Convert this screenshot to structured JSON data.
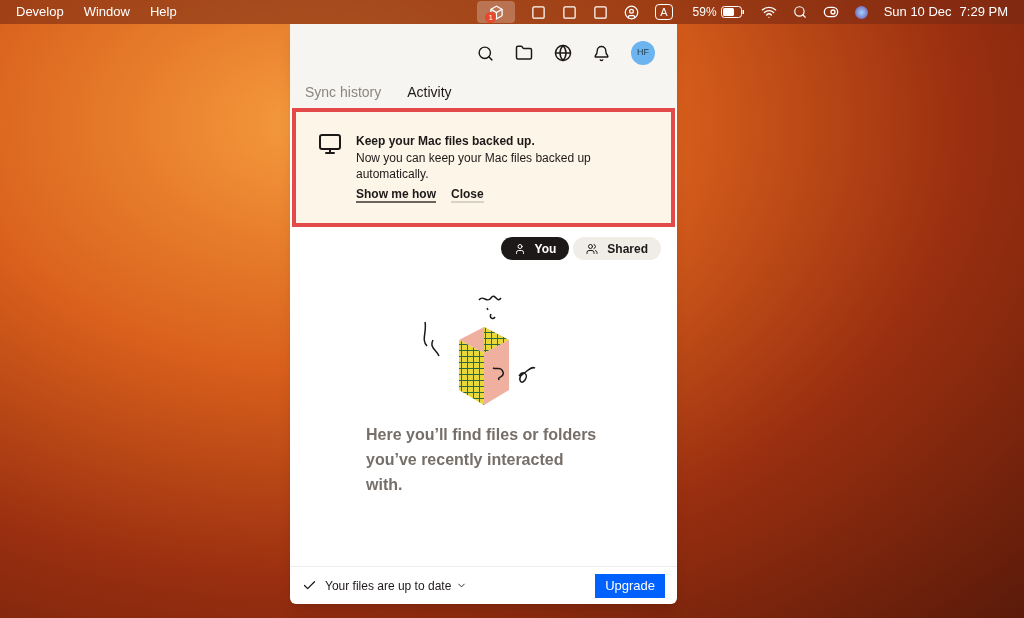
{
  "menubar": {
    "menus": [
      "Develop",
      "Window",
      "Help"
    ],
    "dropbox_badge": "1",
    "input_source": "A",
    "battery_percent": "59%",
    "date": "Sun 10 Dec",
    "time": "7:29 PM"
  },
  "popup": {
    "avatar_initials": "HF",
    "tabs": [
      {
        "label": "Sync history",
        "selected": false
      },
      {
        "label": "Activity",
        "selected": true
      }
    ],
    "banner": {
      "highlighted": true,
      "title": "Keep your Mac files backed up.",
      "body": "Now you can keep your Mac files backed up automatically.",
      "actions": [
        "Show me how",
        "Close"
      ]
    },
    "filters": [
      {
        "label": "You",
        "selected": true,
        "kind": "person"
      },
      {
        "label": "Shared",
        "selected": false,
        "kind": "people"
      }
    ],
    "empty_message": "Here you’ll find files or folders you’ve recently interacted with.",
    "status": "Your files are up to date",
    "upgrade": "Upgrade"
  }
}
